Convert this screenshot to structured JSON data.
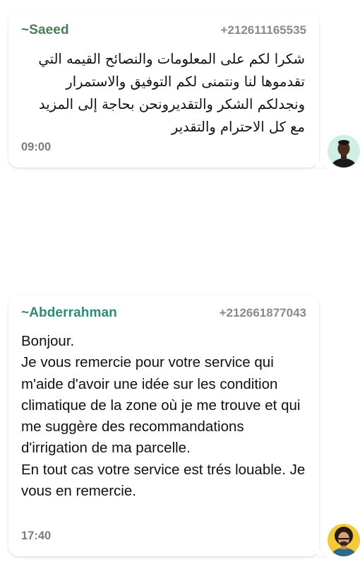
{
  "messages": [
    {
      "sender": "~Saeed",
      "phone": "+212611165535",
      "text": "شكرا لكم على المعلومات والنصائح القيمه التي تقدموها لنا ونتمنى لكم التوفيق والاستمرار ونجدلكم الشكر والتقديرونحن بحاجة إلى المزيد مع كل الاحترام والتقدير",
      "time": "09:00",
      "sender_color": "#4b7d54",
      "avatar_bg": "#cfeee4"
    },
    {
      "sender": "~Abderrahman",
      "phone": "+212661877043",
      "text": "Bonjour.\nJe vous remercie pour votre service qui m'aide d'avoir une idée sur les condition climatique de la zone où je me trouve et qui me suggère des recommandations d'irrigation de ma parcelle.\nEn tout cas votre service est trés louable. Je vous en remercie.",
      "time": "17:40",
      "sender_color": "#2f8a78",
      "avatar_bg": "#f2ca3a"
    }
  ]
}
